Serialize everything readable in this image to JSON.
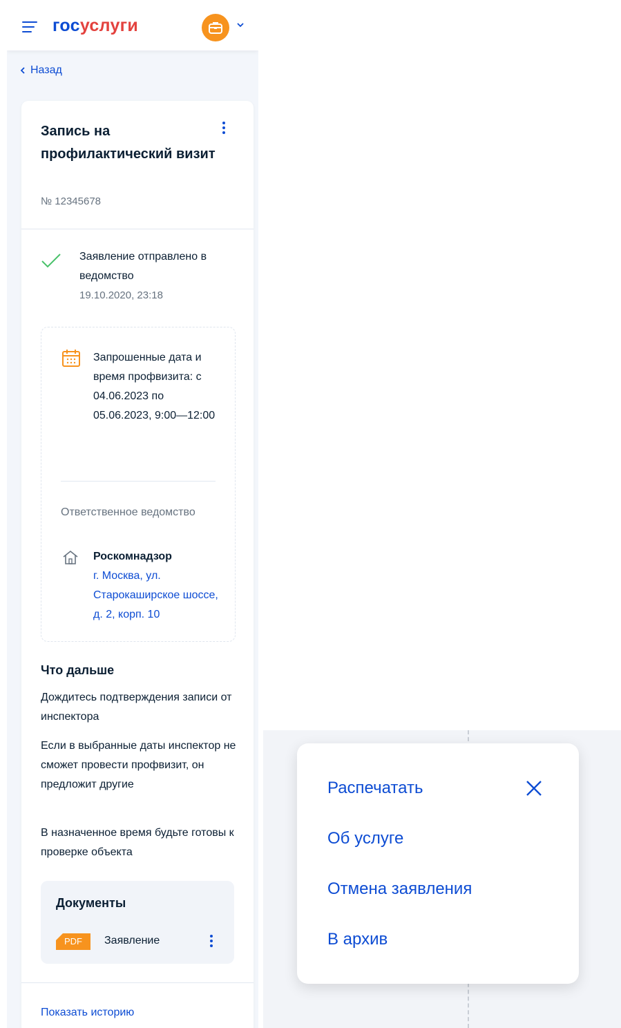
{
  "header": {
    "logo_part1": "гос",
    "logo_part2": "услуги"
  },
  "back": {
    "label": "Назад"
  },
  "card": {
    "title": "Запись на профилактический визит",
    "number": "№ 12345678",
    "status": {
      "text": "Заявление отправлено в ведомство",
      "time": "19.10.2020, 23:18"
    },
    "request": {
      "text": "Запрошенные дата и время профвизита: с 04.06.2023 по 05.06.2023, 9:00—12:00"
    },
    "responsible": {
      "label": "Ответственное ведомство",
      "agency": "Роскомнадзор",
      "address": "г. Москва, ул. Старокаширское шоссе, д. 2, корп. 10"
    },
    "next": {
      "heading": "Что дальше",
      "paragraphs": [
        "Дождитесь подтверждения записи от инспектора",
        "Если в выбранные даты инспектор не сможет провести профвизит, он предложит другие",
        "В назначенное время будьте готовы к проверке объекта"
      ]
    },
    "documents": {
      "heading": "Документы",
      "items": [
        {
          "badge": "PDF",
          "name": "Заявление"
        }
      ]
    },
    "history_link": "Показать историю"
  },
  "menu": {
    "items": [
      "Распечатать",
      "Об услуге",
      "Отмена заявления",
      "В архив"
    ]
  },
  "colors": {
    "primary": "#0d4cd3",
    "logo_red": "#e3423e",
    "accent_orange": "#f7931e",
    "success_green": "#48c169",
    "text": "#0b1f33",
    "muted": "#66727f"
  }
}
